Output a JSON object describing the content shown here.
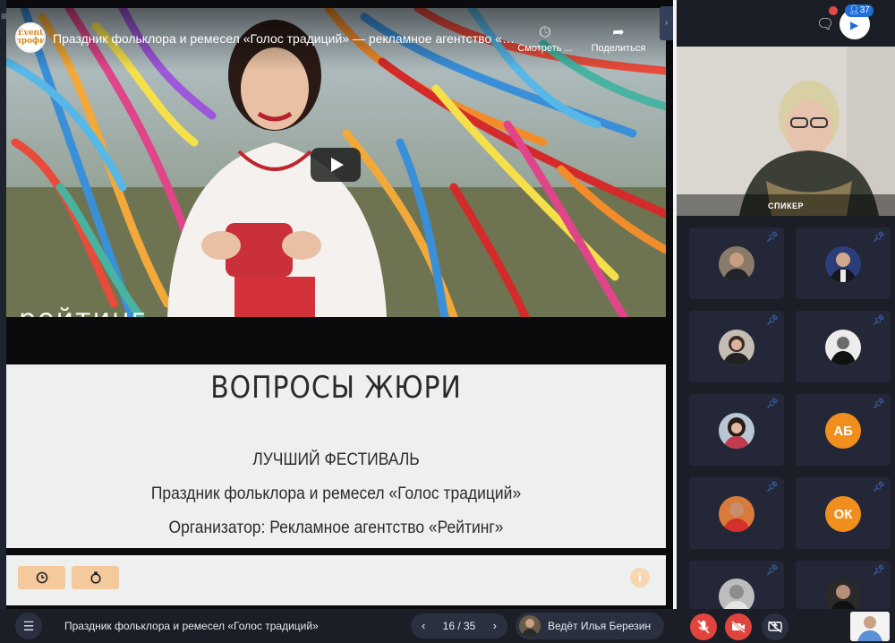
{
  "video": {
    "channel_logo_text": "Event\nпрофи",
    "title": "Праздник фольклора и ремесел «Голос традиций» — рекламное агентство «Рейтинг»",
    "watch_later_label": "Смотреть ...",
    "share_label": "Поделиться",
    "watermark": "рейтинг"
  },
  "slide": {
    "heading": "ВОПРОСЫ ЖЮРИ",
    "line1": "ЛУЧШИЙ ФЕСТИВАЛЬ",
    "line2": "Праздник фольклора и ремесел «Голос традиций»",
    "line3": "Организатор: Рекламное агентство «Рейтинг»"
  },
  "slide_tools": {
    "clock_icon": "clock-icon",
    "timer_icon": "stopwatch-icon",
    "info_label": "i"
  },
  "header": {
    "participants_count": "37"
  },
  "speaker": {
    "label": "СПИКЕР"
  },
  "participants": [
    {
      "type": "photo",
      "initials": ""
    },
    {
      "type": "photo",
      "initials": ""
    },
    {
      "type": "photo",
      "initials": ""
    },
    {
      "type": "photo",
      "initials": ""
    },
    {
      "type": "photo",
      "initials": ""
    },
    {
      "type": "initials",
      "initials": "АБ"
    },
    {
      "type": "photo",
      "initials": ""
    },
    {
      "type": "initials",
      "initials": "ОК"
    },
    {
      "type": "photo",
      "initials": ""
    },
    {
      "type": "photo",
      "initials": ""
    }
  ],
  "bottombar": {
    "event_name": "Праздник фольклора и ремесел «Голос традиций»",
    "pages": "16 / 35",
    "presenter": "Ведёт Илья Березин"
  },
  "colors": {
    "accent_orange": "#f08f1d",
    "danger_red": "#e0453d",
    "pin_blue": "#4a8dff",
    "panel_bg": "#1b1e27"
  }
}
